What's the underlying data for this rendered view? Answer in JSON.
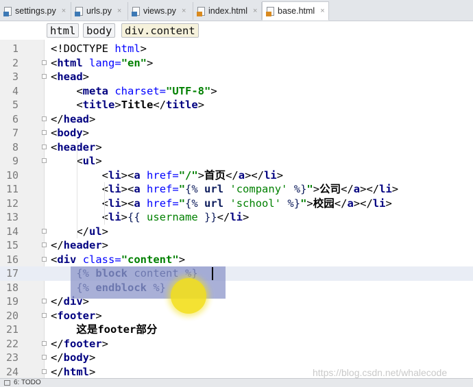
{
  "tabs": [
    {
      "label": "settings.py",
      "type": "py",
      "active": false
    },
    {
      "label": "urls.py",
      "type": "py",
      "active": false
    },
    {
      "label": "views.py",
      "type": "py",
      "active": false
    },
    {
      "label": "index.html",
      "type": "html",
      "active": false
    },
    {
      "label": "base.html",
      "type": "html",
      "active": true
    }
  ],
  "close_glyph": "×",
  "breadcrumb": [
    "html",
    "body",
    "div.content"
  ],
  "code_lines": [
    {
      "num": "1",
      "html": "&lt;!DOCTYPE <span class=\"attr\">html</span>&gt;"
    },
    {
      "num": "2",
      "html": "&lt;<span class=\"tag\">html</span> <span class=\"attr\">lang=</span><span class=\"str\">\"en\"</span>&gt;"
    },
    {
      "num": "3",
      "html": "&lt;<span class=\"tag\">head</span>&gt;"
    },
    {
      "num": "4",
      "html": "    &lt;<span class=\"tag\">meta</span> <span class=\"attr\">charset=</span><span class=\"str\">\"UTF-8\"</span>&gt;"
    },
    {
      "num": "5",
      "html": "    &lt;<span class=\"tag\">title</span>&gt;<b>Title</b>&lt;/<span class=\"tag\">title</span>&gt;"
    },
    {
      "num": "6",
      "html": "&lt;/<span class=\"tag\">head</span>&gt;"
    },
    {
      "num": "7",
      "html": "&lt;<span class=\"tag\">body</span>&gt;"
    },
    {
      "num": "8",
      "html": "&lt;<span class=\"tag\">header</span>&gt;"
    },
    {
      "num": "9",
      "html": "    &lt;<span class=\"tag\">ul</span>&gt;"
    },
    {
      "num": "10",
      "html": "        &lt;<span class=\"tag\">li</span>&gt;&lt;<span class=\"tag\">a</span> <span class=\"attr\">href=</span><span class=\"str\">\"/\"</span>&gt;<b>首页</b>&lt;/<span class=\"tag\">a</span>&gt;&lt;/<span class=\"tag\">li</span>&gt;"
    },
    {
      "num": "11",
      "html": "        &lt;<span class=\"tag\">li</span>&gt;&lt;<span class=\"tag\">a</span> <span class=\"attr\">href=</span><span class=\"str\">\"</span><span class=\"tpl\">{% </span><span class=\"kw\">url</span> <span class=\"tstr\">'company'</span> <span class=\"tpl\">%}</span><span class=\"str\">\"</span>&gt;<b>公司</b>&lt;/<span class=\"tag\">a</span>&gt;&lt;/<span class=\"tag\">li</span>&gt;"
    },
    {
      "num": "12",
      "html": "        &lt;<span class=\"tag\">li</span>&gt;&lt;<span class=\"tag\">a</span> <span class=\"attr\">href=</span><span class=\"str\">\"</span><span class=\"tpl\">{% </span><span class=\"kw\">url</span> <span class=\"tstr\">'school'</span> <span class=\"tpl\">%}</span><span class=\"str\">\"</span>&gt;<b>校园</b>&lt;/<span class=\"tag\">a</span>&gt;&lt;/<span class=\"tag\">li</span>&gt;"
    },
    {
      "num": "13",
      "html": "        &lt;<span class=\"tag\">li</span>&gt;<span class=\"tpl\">{{ </span><span class=\"tstr\">username</span><span class=\"tpl\"> }}</span>&lt;/<span class=\"tag\">li</span>&gt;"
    },
    {
      "num": "14",
      "html": "    &lt;/<span class=\"tag\">ul</span>&gt;"
    },
    {
      "num": "15",
      "html": "&lt;/<span class=\"tag\">header</span>&gt;"
    },
    {
      "num": "16",
      "html": "&lt;<span class=\"tag\">div</span> <span class=\"attr\">class=</span><span class=\"str\">\"content\"</span>&gt;"
    },
    {
      "num": "17",
      "html": "    <span class=\"tpl\">{% </span><span class=\"kw\">block</span> <span class=\"tpl\">content %}</span>"
    },
    {
      "num": "18",
      "html": "    <span class=\"tpl\">{% </span><span class=\"kw\">endblock</span> <span class=\"tpl\">%}</span>"
    },
    {
      "num": "19",
      "html": "&lt;/<span class=\"tag\">div</span>&gt;"
    },
    {
      "num": "20",
      "html": "&lt;<span class=\"tag\">footer</span>&gt;"
    },
    {
      "num": "21",
      "html": "    <b>这是footer部分</b>"
    },
    {
      "num": "22",
      "html": "&lt;/<span class=\"tag\">footer</span>&gt;"
    },
    {
      "num": "23",
      "html": "&lt;/<span class=\"tag\">body</span>&gt;"
    },
    {
      "num": "24",
      "html": "&lt;/<span class=\"tag\">html</span>&gt;"
    }
  ],
  "current_line": "17",
  "watermark": "https://blog.csdn.net/whalecode",
  "statusbar": {
    "todo_label": "6: TODO"
  },
  "colors": {
    "selection": "#8c95c9",
    "highlight_spot": "#f3df1c",
    "tag": "#000080",
    "string": "#008000"
  }
}
